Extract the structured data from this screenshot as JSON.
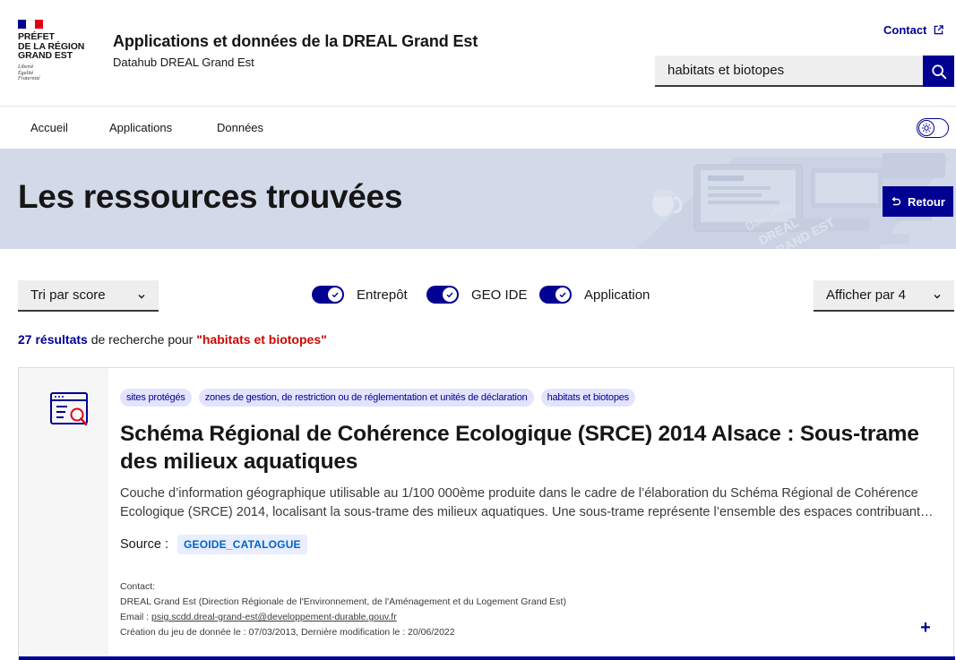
{
  "header": {
    "bloc_lines": [
      "PRÉFET",
      "DE LA RÉGION",
      "GRAND EST"
    ],
    "devise": [
      "Liberté",
      "Égalité",
      "Fraternité"
    ],
    "title": "Applications et données de la DREAL Grand Est",
    "subtitle": "Datahub DREAL Grand Est",
    "contact_label": "Contact",
    "search_value": "habitats et biotopes"
  },
  "nav": {
    "items": [
      "Accueil",
      "Applications",
      "Données"
    ]
  },
  "banner": {
    "title": "Les ressources trouvées",
    "back_label": "Retour"
  },
  "controls": {
    "sort_label": "Tri par score",
    "per_page_label": "Afficher par 4",
    "filters": [
      "Entrepôt",
      "GEO IDE",
      "Application"
    ]
  },
  "results": {
    "count": "27 résultats",
    "text": " de recherche pour ",
    "query": "\"habitats et biotopes\""
  },
  "card": {
    "tags": [
      "sites protégés",
      "zones de gestion, de restriction ou de réglementation et unités de déclaration",
      "habitats et biotopes"
    ],
    "title": "Schéma Régional de Cohérence Ecologique (SRCE) 2014 Alsace : Sous-trame des milieux aquatiques",
    "description": "Couche d’information géographique utilisable au 1/100 000ème produite dans le cadre de l’élaboration du Schéma Régional de Cohérence Ecologique (SRCE) 2014, localisant la sous-trame des milieux aquatiques. Une sous-trame représente l’ensemble des espaces contribuant à la formation des continuités écologiques.",
    "source_label": "Source :",
    "source_value": "GEOIDE_CATALOGUE",
    "contact_label": "Contact:",
    "contact_org": "DREAL Grand Est (Direction Régionale de l'Environnement, de l'Aménagement et du Logement Grand Est)",
    "email_label": "Email : ",
    "email": "psig.scdd.dreal-grand-est@developpement-durable.gouv.fr",
    "dates": "Création du jeu de donnée le : 07/03/2013, Dernière modification le : 20/06/2022",
    "expand_symbol": "+"
  },
  "colors": {
    "primary_blue": "#000091",
    "marianne_red": "#e1000f",
    "banner_bg": "#d2d9e8",
    "tag_bg": "#e3e3fd",
    "query_red": "#ce0500"
  }
}
